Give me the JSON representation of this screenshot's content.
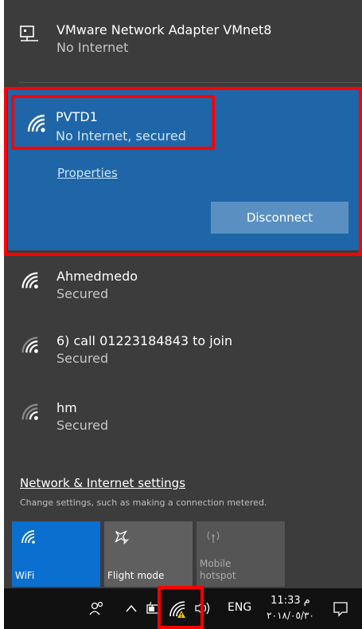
{
  "networks": {
    "vmnet": {
      "name": "VMware Network Adapter VMnet8",
      "status": "No Internet",
      "icon": "ethernet-icon"
    },
    "active": {
      "name": "PVTD1",
      "status": "No Internet, secured",
      "icon": "wifi-icon",
      "properties_label": "Properties",
      "disconnect_label": "Disconnect"
    },
    "list": [
      {
        "name": "Ahmedmedo",
        "status": "Secured",
        "icon": "wifi-icon"
      },
      {
        "name": "6) call 01223184843 to join",
        "status": "Secured",
        "icon": "wifi-icon"
      },
      {
        "name": "hm",
        "status": "Secured",
        "icon": "wifi-icon"
      }
    ]
  },
  "settings": {
    "link": "Network & Internet settings",
    "description": "Change settings, such as making a connection metered."
  },
  "quick_actions": {
    "wifi": {
      "label": "WiFi",
      "icon": "wifi-icon"
    },
    "flight": {
      "label": "Flight mode",
      "icon": "airplane-icon"
    },
    "hotspot": {
      "label": "Mobile hotspot",
      "icon": "hotspot-icon"
    }
  },
  "taskbar": {
    "language": "ENG",
    "time": "11:33 م",
    "date": "٢٠١٨/٠٥/٣٠"
  },
  "colors": {
    "panel_bg": "#3c3c3c",
    "active_bg": "#1e66a8",
    "wifi_tile": "#0b6fcf",
    "highlight": "#ff0000",
    "warning": "#f5c400"
  }
}
